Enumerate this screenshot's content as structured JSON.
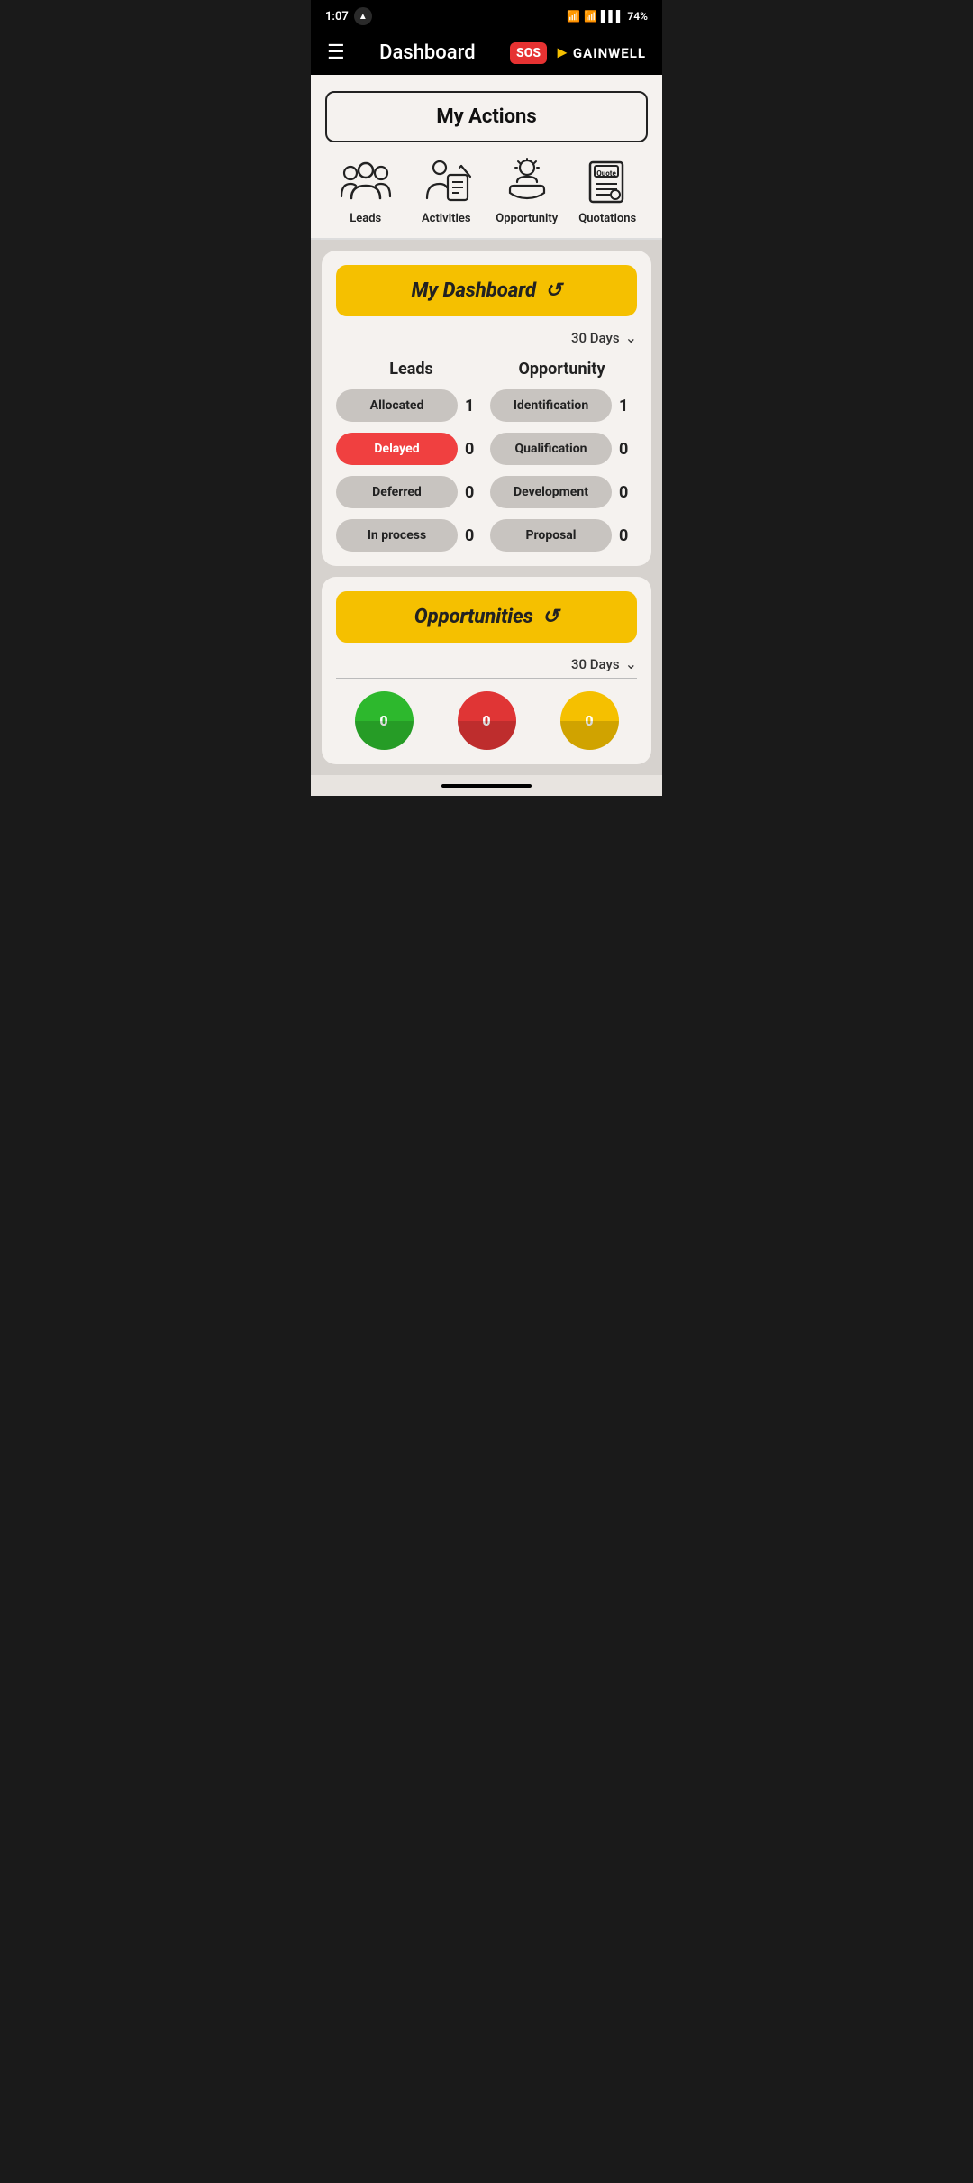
{
  "statusBar": {
    "time": "1:07",
    "battery": "74%",
    "batteryIcon": "🔋"
  },
  "topNav": {
    "title": "Dashboard",
    "sosBadge": "SOS",
    "brandName": "GAINWELL"
  },
  "myActions": {
    "sectionTitle": "My Actions",
    "items": [
      {
        "id": "leads",
        "label": "Leads",
        "icon": "leads-icon"
      },
      {
        "id": "activities",
        "label": "Activities",
        "icon": "activities-icon"
      },
      {
        "id": "opportunity",
        "label": "Opportunity",
        "icon": "opportunity-icon"
      },
      {
        "id": "quotations",
        "label": "Quotations",
        "icon": "quotations-icon"
      }
    ]
  },
  "myDashboard": {
    "title": "My Dashboard",
    "period": "30 Days",
    "leadsColumnTitle": "Leads",
    "opportunityColumnTitle": "Opportunity",
    "leadsStats": [
      {
        "label": "Allocated",
        "count": "1",
        "style": "normal"
      },
      {
        "label": "Delayed",
        "count": "0",
        "style": "delayed"
      },
      {
        "label": "Deferred",
        "count": "0",
        "style": "normal"
      },
      {
        "label": "In process",
        "count": "0",
        "style": "normal"
      }
    ],
    "opportunityStats": [
      {
        "label": "Identification",
        "count": "1",
        "style": "normal"
      },
      {
        "label": "Qualification",
        "count": "0",
        "style": "normal"
      },
      {
        "label": "Development",
        "count": "0",
        "style": "normal"
      },
      {
        "label": "Proposal",
        "count": "0",
        "style": "normal"
      }
    ]
  },
  "opportunities": {
    "title": "Opportunities",
    "period": "30 Days",
    "charts": [
      {
        "color": "green",
        "value": "0"
      },
      {
        "color": "red",
        "value": "0"
      },
      {
        "color": "yellow",
        "value": "0"
      }
    ]
  }
}
